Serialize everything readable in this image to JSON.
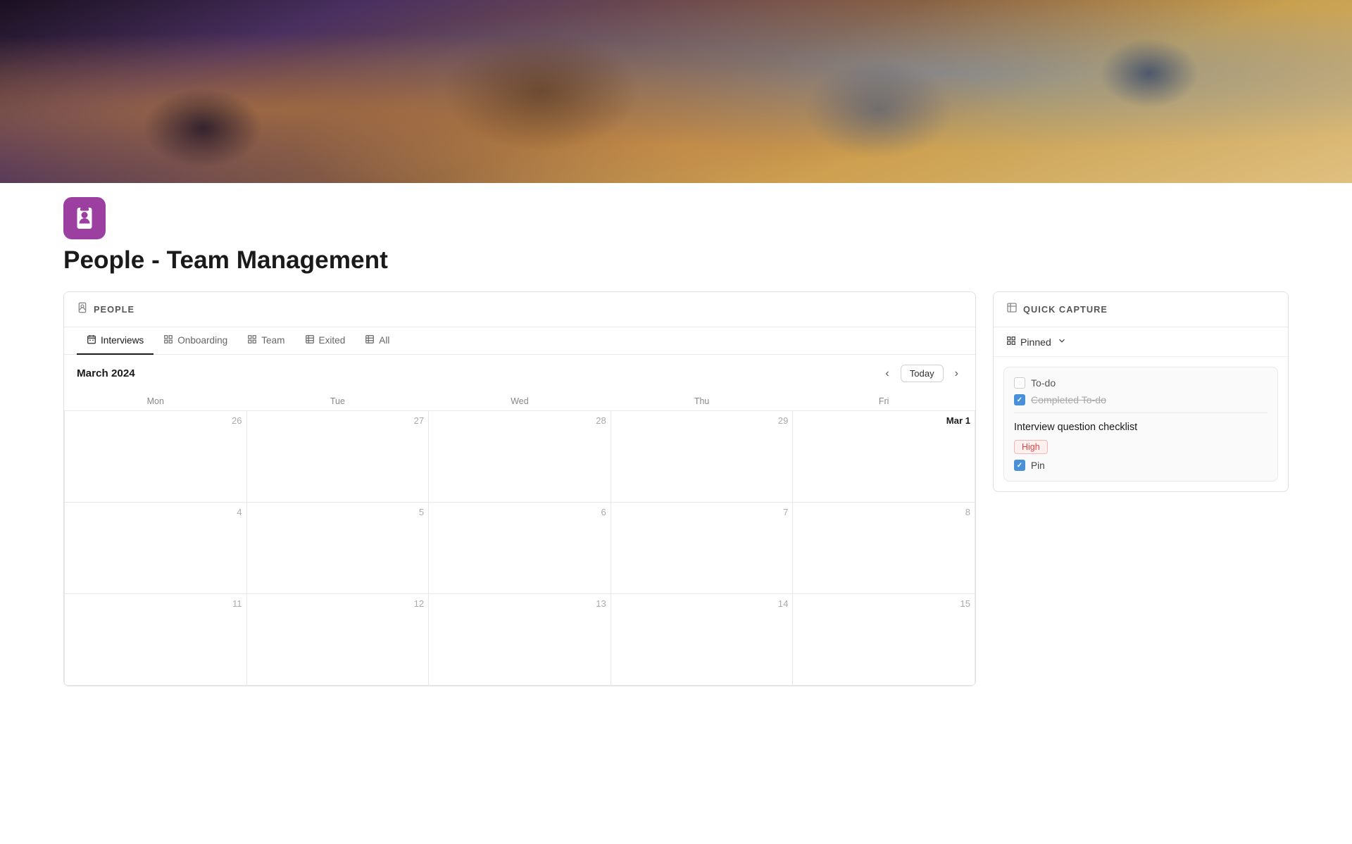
{
  "hero": {
    "alt": "Team collaboration with lego figures"
  },
  "page": {
    "icon_label": "person-badge",
    "title": "People - Team Management"
  },
  "people_panel": {
    "header_icon": "person-badge",
    "header_title": "PEOPLE",
    "tabs": [
      {
        "label": "Interviews",
        "active": true,
        "icon": "calendar-lines"
      },
      {
        "label": "Onboarding",
        "active": false,
        "icon": "grid"
      },
      {
        "label": "Team",
        "active": false,
        "icon": "grid"
      },
      {
        "label": "Exited",
        "active": false,
        "icon": "table"
      },
      {
        "label": "All",
        "active": false,
        "icon": "table"
      }
    ],
    "calendar": {
      "month": "March 2024",
      "today_label": "Today",
      "days_of_week": [
        "Mon",
        "Tue",
        "Wed",
        "Thu",
        "Fri"
      ],
      "weeks": [
        [
          {
            "number": "26",
            "current": false
          },
          {
            "number": "27",
            "current": false
          },
          {
            "number": "28",
            "current": false
          },
          {
            "number": "29",
            "current": false
          },
          {
            "number": "Mar 1",
            "current": true,
            "highlight": true
          }
        ],
        [
          {
            "number": "4",
            "current": true
          },
          {
            "number": "5",
            "current": true
          },
          {
            "number": "6",
            "current": true
          },
          {
            "number": "7",
            "current": true
          },
          {
            "number": "8",
            "current": true
          }
        ],
        [
          {
            "number": "11",
            "current": true
          },
          {
            "number": "12",
            "current": true
          },
          {
            "number": "13",
            "current": true
          },
          {
            "number": "14",
            "current": true
          },
          {
            "number": "15",
            "current": true
          }
        ]
      ]
    }
  },
  "quick_capture": {
    "header_title": "QUICK CAPTURE",
    "pinned_label": "Pinned",
    "card": {
      "todo_items": [
        {
          "label": "To-do",
          "checked": false
        },
        {
          "label": "Completed To-do",
          "checked": true
        }
      ],
      "title": "Interview question checklist",
      "priority": "High",
      "priority_level": "high",
      "pin_label": "Pin",
      "pin_checked": true
    }
  }
}
